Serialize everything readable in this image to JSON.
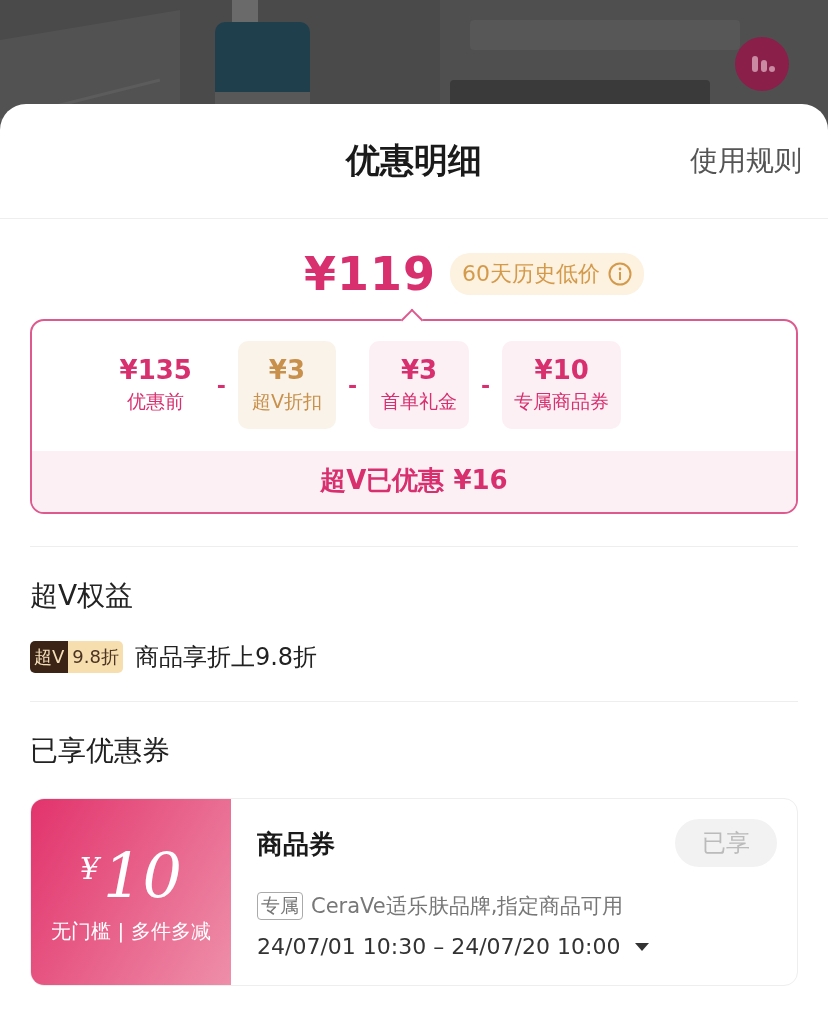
{
  "sheet": {
    "title": "优惠明细",
    "rules_link": "使用规则"
  },
  "price": {
    "final": "¥119",
    "badge": "60天历史低价"
  },
  "breakdown": {
    "items": [
      {
        "kind": "base",
        "amount": "¥135",
        "label": "优惠前"
      },
      {
        "kind": "vip",
        "amount": "¥3",
        "label": "超V折扣"
      },
      {
        "kind": "promo",
        "amount": "¥3",
        "label": "首单礼金"
      },
      {
        "kind": "promo",
        "amount": "¥10",
        "label": "专属商品券"
      }
    ],
    "operator": "-",
    "total": "超V已优惠 ¥16"
  },
  "vip_section": {
    "title": "超V权益",
    "badge_left": "超V",
    "badge_right": "9.8折",
    "text": "商品享折上9.8折"
  },
  "coupon_section": {
    "title": "已享优惠券",
    "coupons": [
      {
        "currency": "¥",
        "amount": "10",
        "conditions": "无门槛 | 多件多减",
        "name": "商品券",
        "button": "已享",
        "disabled": true,
        "tag": "专属",
        "description": "CeraVe适乐肤品牌,指定商品可用",
        "validity": "24/07/01 10:30 – 24/07/20 10:00",
        "expanded": false
      }
    ]
  }
}
